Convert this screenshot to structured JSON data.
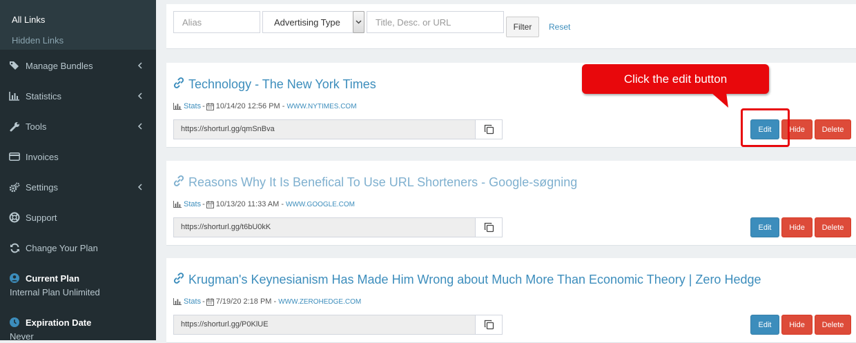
{
  "sidebar": {
    "sub_items": [
      {
        "label": "All Links",
        "active": true
      },
      {
        "label": "Hidden Links",
        "active": false
      }
    ],
    "nav": [
      {
        "label": "Manage Bundles",
        "icon": "tags-icon",
        "has_chevron": true
      },
      {
        "label": "Statistics",
        "icon": "bar-chart-icon",
        "has_chevron": true
      },
      {
        "label": "Tools",
        "icon": "wrench-icon",
        "has_chevron": true
      },
      {
        "label": "Invoices",
        "icon": "credit-card-icon",
        "has_chevron": false
      },
      {
        "label": "Settings",
        "icon": "gears-icon",
        "has_chevron": true
      },
      {
        "label": "Support",
        "icon": "life-ring-icon",
        "has_chevron": false
      },
      {
        "label": "Change Your Plan",
        "icon": "refresh-icon",
        "has_chevron": false
      }
    ],
    "current_plan": {
      "title": "Current Plan",
      "value": "Internal Plan Unlimited",
      "icon": "user-circle-icon"
    },
    "expiration": {
      "title": "Expiration Date",
      "value": "Never",
      "icon": "clock-icon"
    }
  },
  "filter": {
    "alias_placeholder": "Alias",
    "type_select": "Advertising Type",
    "search_placeholder": "Title, Desc. or URL",
    "filter_label": "Filter",
    "reset_label": "Reset"
  },
  "links": [
    {
      "title": "Technology - The New York Times",
      "visited": false,
      "stats_label": "Stats",
      "date": "10/14/20 12:56 PM -",
      "domain": "WWW.NYTIMES.COM",
      "short_url": "https://shorturl.gg/qmSnBva",
      "edit_label": "Edit",
      "hide_label": "Hide",
      "delete_label": "Delete"
    },
    {
      "title": "Reasons Why It Is Benefical To Use URL Shorteners - Google-søgning",
      "visited": true,
      "stats_label": "Stats",
      "date": "10/13/20 11:33 AM -",
      "domain": "WWW.GOOGLE.COM",
      "short_url": "https://shorturl.gg/t6bU0kK",
      "edit_label": "Edit",
      "hide_label": "Hide",
      "delete_label": "Delete"
    },
    {
      "title": "Krugman's Keynesianism Has Made Him Wrong about Much More Than Economic Theory | Zero Hedge",
      "visited": false,
      "stats_label": "Stats",
      "date": "7/19/20 2:18 PM -",
      "domain": "WWW.ZEROHEDGE.COM",
      "short_url": "https://shorturl.gg/P0KlUE",
      "edit_label": "Edit",
      "hide_label": "Hide",
      "delete_label": "Delete"
    }
  ],
  "annotation": {
    "text": "Click the edit button",
    "color": "#e8080c"
  },
  "colors": {
    "sidebar": "#222d32",
    "accent": "#3c8dbc",
    "danger": "#dd4b39"
  }
}
